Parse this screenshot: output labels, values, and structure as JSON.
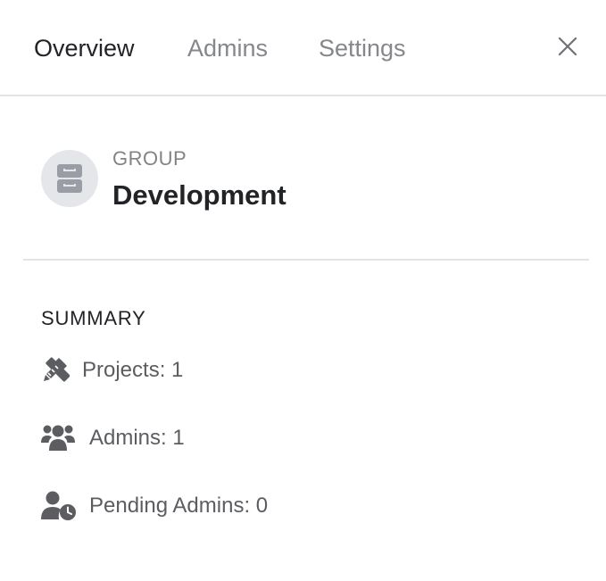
{
  "tabs": {
    "overview": "Overview",
    "admins": "Admins",
    "settings": "Settings"
  },
  "group": {
    "type_label": "GROUP",
    "name": "Development"
  },
  "summary": {
    "title": "SUMMARY",
    "projects": "Projects: 1",
    "admins": "Admins: 1",
    "pending_admins": "Pending Admins: 0"
  },
  "colors": {
    "active_tab": "#222326",
    "inactive_tab": "#85878a",
    "divider": "#e3e4e6",
    "avatar_bg": "#e5e6ea",
    "icon": "#5b5d60"
  },
  "icons": {
    "close": "close-icon",
    "group": "cabinet-icon",
    "projects": "pencil-ruler-icon",
    "admins": "users-icon",
    "pending": "user-clock-icon"
  }
}
